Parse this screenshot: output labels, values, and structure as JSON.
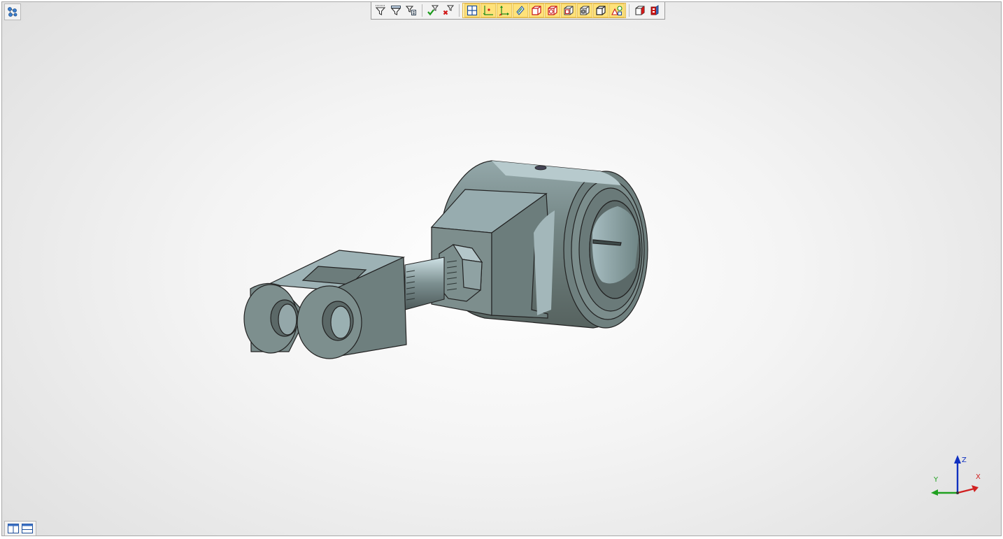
{
  "window": {
    "title": ""
  },
  "toolbar": {
    "groups": [
      {
        "name": "filter",
        "icons": [
          "filter-dots-icon",
          "filter-funnel-icon",
          "filter-list-icon"
        ]
      },
      {
        "name": "filter-apply",
        "icons": [
          "filter-check-icon",
          "filter-clear-icon"
        ]
      },
      {
        "name": "selection-modes",
        "highlighted": true,
        "icons": [
          "select-face-grid-icon",
          "select-point-icon",
          "select-axis-icon",
          "select-plane-icon",
          "select-solid-icon",
          "select-solid-circle-icon",
          "select-solid-box-icon",
          "select-solid-ring-icon",
          "select-solid-shade-icon",
          "select-shapes-icon"
        ]
      },
      {
        "name": "view-modes",
        "icons": [
          "view-box-red-icon",
          "view-part-red-icon"
        ]
      }
    ]
  },
  "viewport": {
    "background": "#e8e8e8",
    "model_color": "#6f8080"
  },
  "triad": {
    "x_label": "X",
    "y_label": "Y",
    "z_label": "Z",
    "x_color": "#d02020",
    "y_color": "#20a020",
    "z_color": "#1030c0"
  },
  "bottom_panel": {
    "icons": [
      "layout-vertical-icon",
      "layout-horizontal-icon"
    ]
  }
}
